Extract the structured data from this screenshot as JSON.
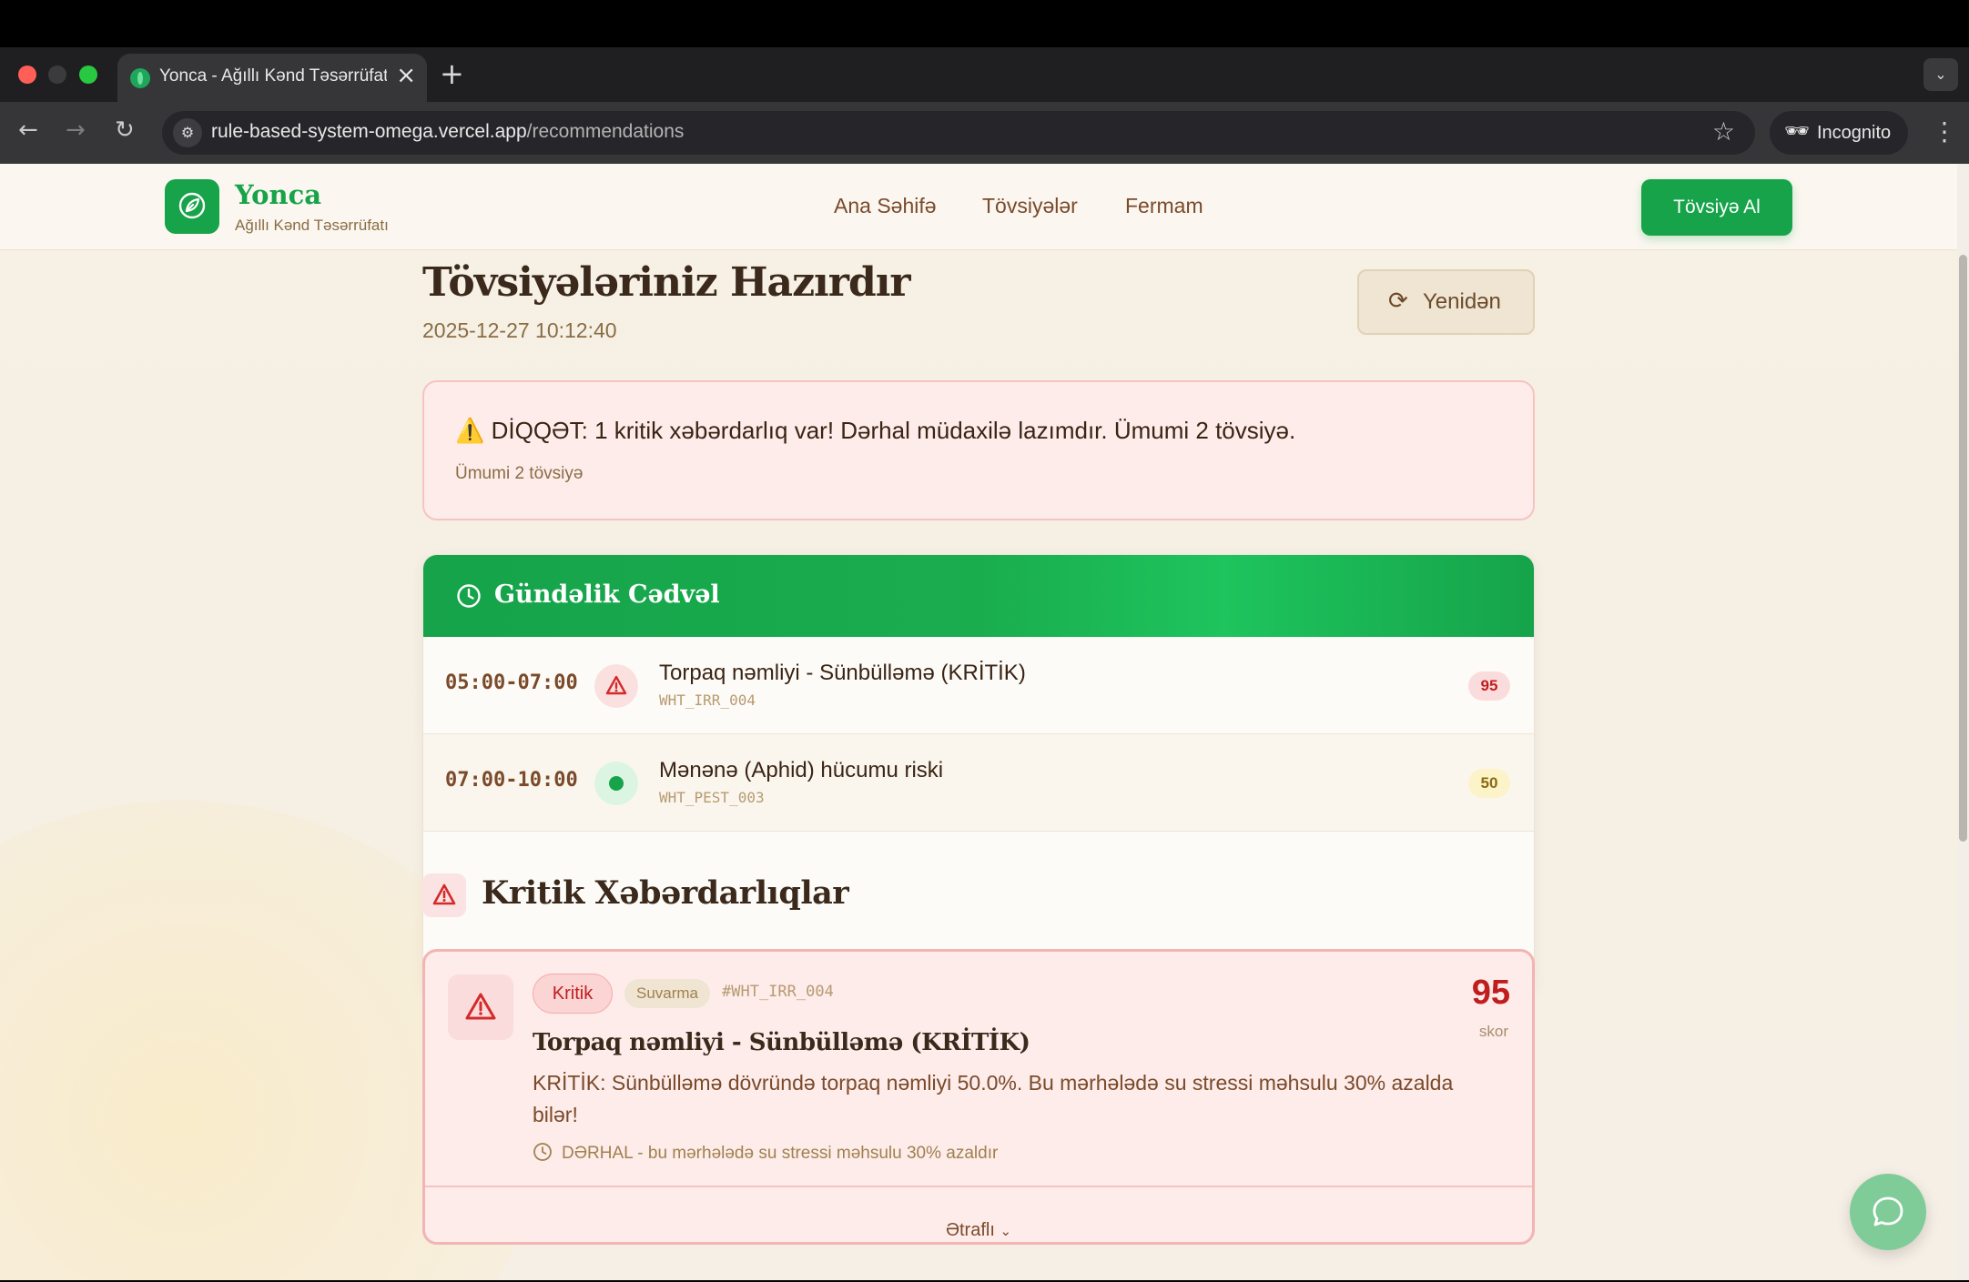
{
  "browser": {
    "tab_title": "Yonca - Ağıllı Kənd Təsərrüfatı",
    "url_host": "rule-based-system-omega.vercel.app",
    "url_path": "/recommendations",
    "incognito_label": "Incognito"
  },
  "header": {
    "brand_name": "Yonca",
    "brand_sub": "Ağıllı Kənd Təsərrüfatı",
    "nav": [
      "Ana Səhifə",
      "Tövsiyələr",
      "Fermam"
    ],
    "cta": "Tövsiyə Al"
  },
  "page": {
    "title": "Tövsiyələriniz Hazırdır",
    "timestamp": "2025-12-27 10:12:40",
    "reload_label": "Yenidən"
  },
  "alert": {
    "icon": "⚠️",
    "main": "DİQQƏT: 1 kritik xəbərdarlıq var! Dərhal müdaxilə lazımdır. Ümumi 2 tövsiyə.",
    "sub": "Ümumi 2 tövsiyə"
  },
  "schedule": {
    "title": "Gündəlik Cədvəl",
    "rows": [
      {
        "time": "05:00-07:00",
        "icon": "warning-triangle-icon",
        "title": "Torpaq nəmliyi - Sünbülləmə (KRİTİK)",
        "code": "WHT_IRR_004",
        "score": "95"
      },
      {
        "time": "07:00-10:00",
        "icon": "green-dot-icon",
        "title": "Mənənə (Aphid) hücumu riski",
        "code": "WHT_PEST_003",
        "score": "50"
      }
    ]
  },
  "critical": {
    "section_title": "Kritik Xəbərdarlıqlar",
    "card": {
      "severity": "Kritik",
      "category": "Suvarma",
      "code": "#WHT_IRR_004",
      "score": "95",
      "score_label": "skor",
      "title": "Torpaq nəmliyi - Sünbülləmə (KRİTİK)",
      "description": "KRİTİK: Sünbülləmə dövründə torpaq nəmliyi 50.0%. Bu mərhələdə su stressi məhsulu 30% azalda bilər!",
      "timing": "DƏRHAL - bu mərhələdə su stressi məhsulu 30% azaldır",
      "details_label": "Ətraflı"
    }
  },
  "colors": {
    "brand_green": "#16a34a",
    "critical_red": "#c01e1e",
    "brown_text": "#7a4a2a"
  }
}
